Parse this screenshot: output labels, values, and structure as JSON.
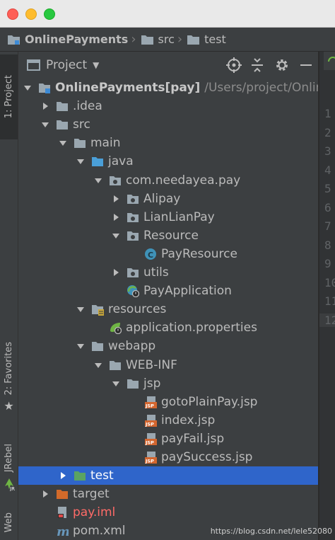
{
  "breadcrumb": [
    "OnlinePayments",
    "src",
    "test"
  ],
  "panel": {
    "title": "Project"
  },
  "left_tabs": {
    "project": "1: Project",
    "favorites": "2: Favorites",
    "jrebel": "JRebel",
    "jr_badge": "JR",
    "web": "Web"
  },
  "gutter_numbers": [
    "1",
    "2",
    "3",
    "4",
    "5",
    "6",
    "7",
    "8",
    "9",
    "10",
    "11",
    "12"
  ],
  "tree": [
    {
      "label": "OnlinePayments",
      "suffix": " [pay]",
      "path": "/Users/project/Onlin",
      "depth": 0,
      "arrow": "down",
      "icon": "module",
      "style": "bold"
    },
    {
      "label": ".idea",
      "depth": 1,
      "arrow": "right",
      "icon": "folder"
    },
    {
      "label": "src",
      "depth": 1,
      "arrow": "down",
      "icon": "folder"
    },
    {
      "label": "main",
      "depth": 2,
      "arrow": "down",
      "icon": "folder"
    },
    {
      "label": "java",
      "depth": 3,
      "arrow": "down",
      "icon": "folder-blue"
    },
    {
      "label": "com.needayea.pay",
      "depth": 4,
      "arrow": "down",
      "icon": "package"
    },
    {
      "label": "Alipay",
      "depth": 5,
      "arrow": "right",
      "icon": "package"
    },
    {
      "label": "LianLianPay",
      "depth": 5,
      "arrow": "right",
      "icon": "package"
    },
    {
      "label": "Resource",
      "depth": 5,
      "arrow": "down",
      "icon": "package"
    },
    {
      "label": "PayResource",
      "depth": 6,
      "arrow": "none",
      "icon": "class"
    },
    {
      "label": "utils",
      "depth": 5,
      "arrow": "right",
      "icon": "package"
    },
    {
      "label": "PayApplication",
      "depth": 5,
      "arrow": "none",
      "icon": "spring-app"
    },
    {
      "label": "resources",
      "depth": 3,
      "arrow": "down",
      "icon": "folder-res"
    },
    {
      "label": "application.properties",
      "depth": 4,
      "arrow": "none",
      "icon": "spring-prop"
    },
    {
      "label": "webapp",
      "depth": 3,
      "arrow": "down",
      "icon": "folder"
    },
    {
      "label": "WEB-INF",
      "depth": 4,
      "arrow": "down",
      "icon": "folder"
    },
    {
      "label": "jsp",
      "depth": 5,
      "arrow": "down",
      "icon": "folder"
    },
    {
      "label": "gotoPlainPay.jsp",
      "depth": 6,
      "arrow": "none",
      "icon": "jsp"
    },
    {
      "label": "index.jsp",
      "depth": 6,
      "arrow": "none",
      "icon": "jsp"
    },
    {
      "label": "payFail.jsp",
      "depth": 6,
      "arrow": "none",
      "icon": "jsp"
    },
    {
      "label": "paySuccess.jsp",
      "depth": 6,
      "arrow": "none",
      "icon": "jsp"
    },
    {
      "label": "test",
      "depth": 2,
      "arrow": "right",
      "icon": "folder-test",
      "selected": true
    },
    {
      "label": "target",
      "depth": 1,
      "arrow": "right",
      "icon": "folder-orange"
    },
    {
      "label": "pay.iml",
      "depth": 1,
      "arrow": "none",
      "icon": "iml",
      "style": "red"
    },
    {
      "label": "pom.xml",
      "depth": 1,
      "arrow": "none",
      "icon": "maven"
    }
  ],
  "icon_badges": {
    "class": "C",
    "jsp": "JSP",
    "maven": "m"
  },
  "watermark": "https://blog.csdn.net/lele52080",
  "colors": {
    "selection": "#2f65ca",
    "folder": "#9aa7b0",
    "folder_blue": "#4a9fd8",
    "folder_orange": "#d26a2a",
    "red": "#ff6b68",
    "jsp": "#d3662f"
  }
}
